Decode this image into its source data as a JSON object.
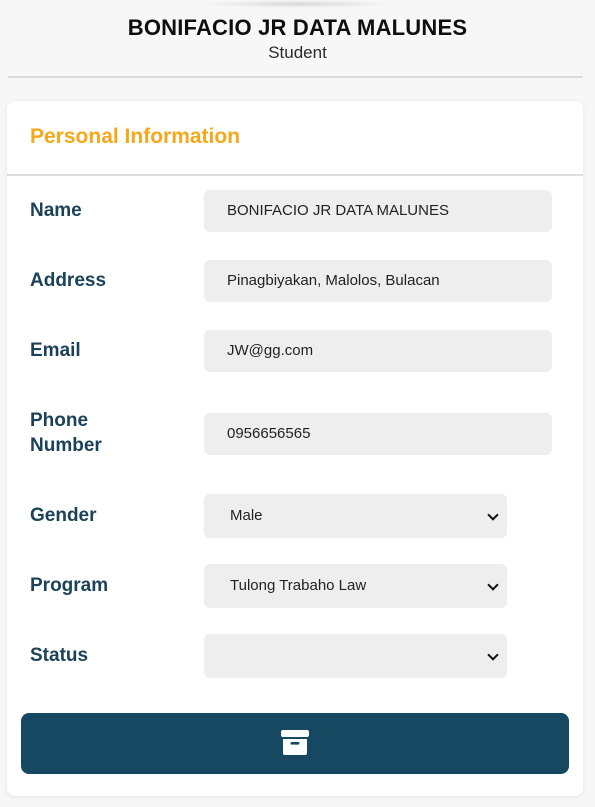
{
  "profile": {
    "name": "BONIFACIO JR DATA MALUNES",
    "role": "Student"
  },
  "section": {
    "title": "Personal Information"
  },
  "fields": {
    "name": {
      "label": "Name",
      "value": "BONIFACIO JR DATA MALUNES"
    },
    "address": {
      "label": "Address",
      "value": "Pinagbiyakan, Malolos, Bulacan"
    },
    "email": {
      "label": "Email",
      "value": "JW@gg.com"
    },
    "phone": {
      "label_line1": "Phone",
      "label_line2": "Number",
      "value": "0956656565"
    },
    "gender": {
      "label": "Gender",
      "selected": "Male"
    },
    "program": {
      "label": "Program",
      "selected": "Tulong Trabaho Law"
    },
    "status": {
      "label": "Status",
      "selected": ""
    }
  },
  "archive_button": {
    "icon": "archive-icon"
  },
  "colors": {
    "accent": "#f5a81c",
    "label": "#1c4259",
    "button": "#174862",
    "field_bg": "#eeeeee"
  }
}
